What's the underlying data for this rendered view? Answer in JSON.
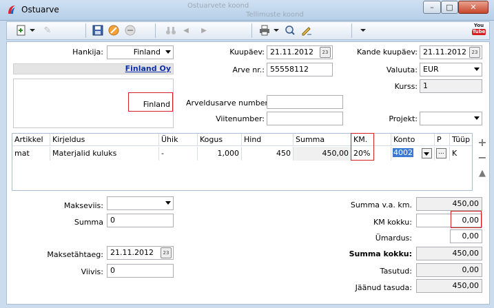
{
  "window": {
    "title": "Ostuarve",
    "background_ghost_text_1": "Ostuarvete koond",
    "background_ghost_text_2": "Tellimuste koond",
    "minimize": "–",
    "maximize": "□",
    "close": "✕"
  },
  "toolbar": {
    "icons": [
      "new-icon",
      "edit-icon",
      "save-icon",
      "cancel-icon",
      "delete-icon",
      "binoculars-icon",
      "prev-icon",
      "next-icon",
      "print-icon",
      "preview-icon",
      "signature-icon",
      "youtube-icon"
    ],
    "youtube_top": "You",
    "youtube_bottom": "Tube"
  },
  "header": {
    "hankija_label": "Hankija:",
    "hankija_value": "Finland",
    "supplier_link": "Finland Oy",
    "address_value": "Finland",
    "kuupaev_label": "Kuupäev:",
    "kuupaev_value": "21.11.2012",
    "arve_nr_label": "Arve nr.:",
    "arve_nr_value": "55558112",
    "arveldusarve_label": "Arveldusarve number:",
    "arveldusarve_value": "",
    "viitenumber_label": "Viitenumber:",
    "viitenumber_value": "",
    "kande_kuupaev_label": "Kande kuupäev:",
    "kande_kuupaev_value": "21.11.2012",
    "valuuta_label": "Valuuta:",
    "valuuta_value": "EUR",
    "kurss_label": "Kurss:",
    "kurss_value": "1",
    "projekt_label": "Projekt:",
    "projekt_value": ""
  },
  "grid": {
    "columns": [
      "Artikkel",
      "Kirjeldus",
      "Ühik",
      "Kogus",
      "Hind",
      "Summa",
      "KM.",
      "Konto",
      "P",
      "Tüüp"
    ],
    "rows": [
      {
        "artikkel": "mat",
        "kirjeldus": "Materjalid kuluks",
        "uhik": "-",
        "kogus": "1,000",
        "hind": "450",
        "summa": "450,00",
        "km": "20%",
        "konto": "4002",
        "p": "...",
        "tuup": "K"
      }
    ]
  },
  "payment": {
    "makseviis_label": "Makseviis:",
    "makseviis_value": "",
    "summa_label": "Summa",
    "summa_value": "0",
    "maksetahtaeg_label": "Maksetähtaeg:",
    "maksetahtaeg_value": "21.11.2012",
    "viivis_label": "Viivis:",
    "viivis_value": "0"
  },
  "totals": {
    "summa_vak_label": "Summa v.a. km.",
    "summa_vak_value": "450,00",
    "km_kokku_label": "KM kokku:",
    "km_kokku_value": "0,00",
    "umardus_label": "Ümardus:",
    "umardus_value": "0,00",
    "summa_kokku_label": "Summa kokku:",
    "summa_kokku_value": "450,00",
    "tasutud_label": "Tasutud:",
    "tasutud_value": "0,00",
    "jaanud_label": "Jäänud tasuda:",
    "jaanud_value": "450,00"
  },
  "colors": {
    "highlight_red": "#d42020",
    "link_blue": "#0b2fa8",
    "selected_blue": "#3b78d4"
  }
}
